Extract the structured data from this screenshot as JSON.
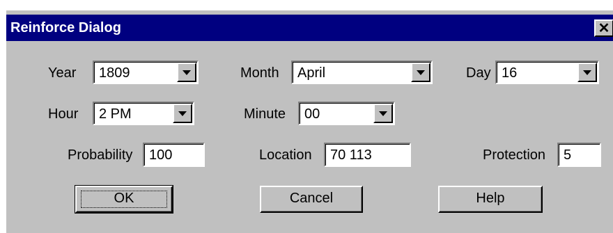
{
  "window": {
    "title": "Reinforce Dialog",
    "close_glyph": "✕"
  },
  "fields": {
    "year": {
      "label": "Year",
      "value": "1809"
    },
    "month": {
      "label": "Month",
      "value": "April"
    },
    "day": {
      "label": "Day",
      "value": "16"
    },
    "hour": {
      "label": "Hour",
      "value": "2 PM"
    },
    "minute": {
      "label": "Minute",
      "value": "00"
    },
    "probability": {
      "label": "Probability",
      "value": "100"
    },
    "location": {
      "label": "Location",
      "value": "70 113"
    },
    "protection": {
      "label": "Protection",
      "value": "5"
    }
  },
  "buttons": {
    "ok": "OK",
    "cancel": "Cancel",
    "help": "Help"
  },
  "colors": {
    "titlebar": "#000080",
    "face": "#c0c0c0",
    "field_bg": "#ffffff"
  },
  "icons": {
    "dropdown": "dropdown-arrow-icon",
    "close": "close-icon"
  }
}
